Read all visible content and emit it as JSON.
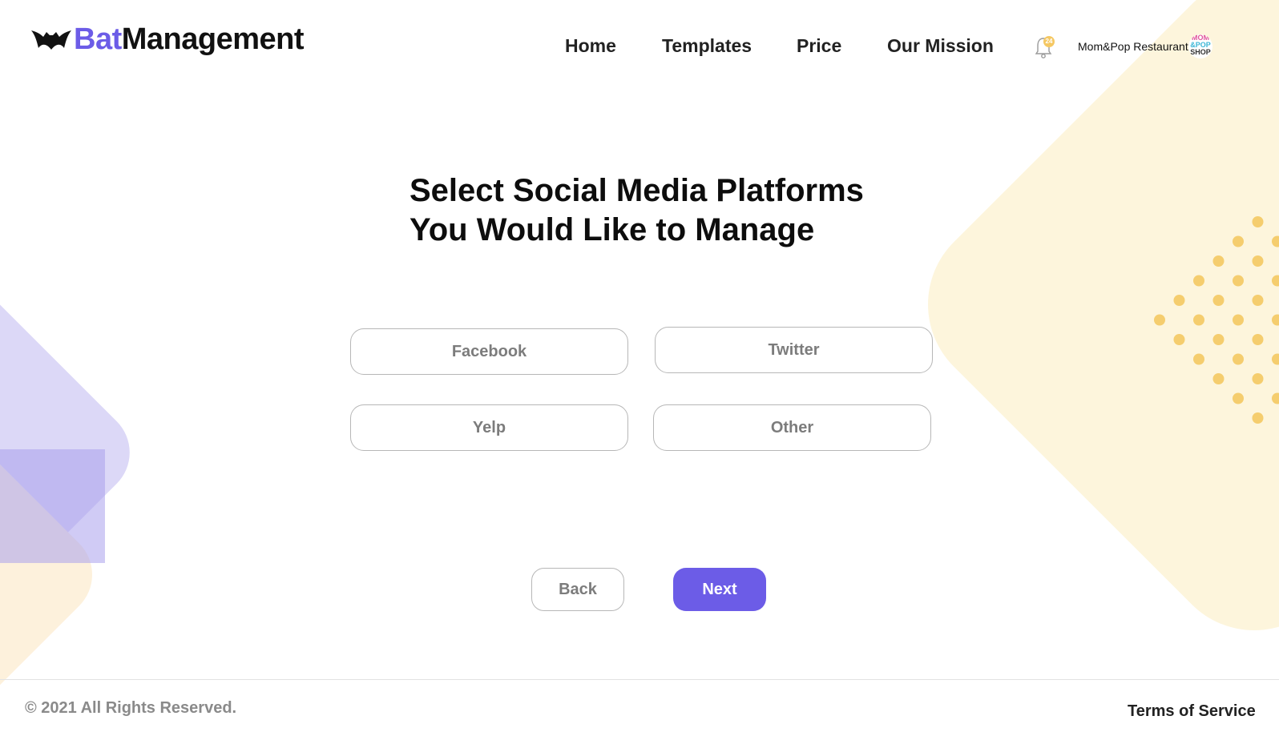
{
  "brand": {
    "name_part1": "Bat",
    "name_part2": "Management",
    "accent_color": "#6c5ce7"
  },
  "nav": {
    "items": [
      {
        "label": "Home"
      },
      {
        "label": "Templates"
      },
      {
        "label": "Price"
      },
      {
        "label": "Our Mission"
      }
    ]
  },
  "notifications": {
    "icon": "bell-icon",
    "badge_count": "24",
    "badge_color": "#f5c863"
  },
  "profile": {
    "name": "Mom&Pop Restaurant",
    "avatar_text": [
      "MOM",
      "&POP",
      "SHOP"
    ]
  },
  "main": {
    "title_line1": "Select Social Media Platforms",
    "title_line2": "You Would Like to Manage",
    "options": [
      {
        "label": "Facebook"
      },
      {
        "label": "Twitter"
      },
      {
        "label": "Yelp"
      },
      {
        "label": "Other"
      }
    ],
    "back_label": "Back",
    "next_label": "Next"
  },
  "footer": {
    "copyright": "© 2021 All Rights Reserved.",
    "terms_label": "Terms of Service"
  },
  "colors": {
    "decor_yellow": "#fdf5dc",
    "decor_dots": "#f5cd6e",
    "decor_lavender": "#dcd8f7"
  }
}
